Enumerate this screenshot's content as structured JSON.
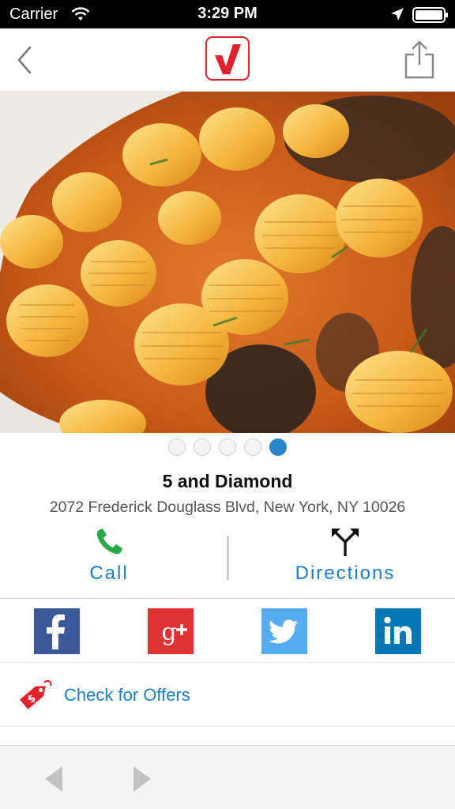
{
  "status_bar": {
    "carrier": "Carrier",
    "time": "3:29 PM",
    "icons": [
      "wifi-icon",
      "location-icon",
      "battery-icon"
    ]
  },
  "nav": {
    "left_icon": "chevron-left-icon",
    "logo": "v-checkmark-logo",
    "right_icon": "share-icon",
    "brand_color": "#e0202a"
  },
  "hero": {
    "image": "pasta-dish-photo",
    "carousel_total": 5,
    "carousel_active": 5
  },
  "place": {
    "name": "5 and Diamond",
    "address": "2072 Frederick Douglass Blvd, New York, NY 10026"
  },
  "actions": {
    "call_label": "Call",
    "call_icon": "phone-icon",
    "directions_label": "Directions",
    "directions_icon": "fork-arrows-icon",
    "link_color": "#1b7fc4"
  },
  "social": [
    {
      "name": "Facebook",
      "icon": "facebook-icon",
      "color": "#3b5998"
    },
    {
      "name": "Google+",
      "icon": "google-plus-icon",
      "color": "#dd3333"
    },
    {
      "name": "Twitter",
      "icon": "twitter-icon",
      "color": "#55acee"
    },
    {
      "name": "LinkedIn",
      "icon": "linkedin-icon",
      "color": "#0077b5"
    }
  ],
  "offers": {
    "label": "Check for Offers",
    "icon": "price-tag-icon"
  },
  "toolbar": {
    "back_icon": "triangle-left-icon",
    "forward_icon": "triangle-right-icon"
  }
}
